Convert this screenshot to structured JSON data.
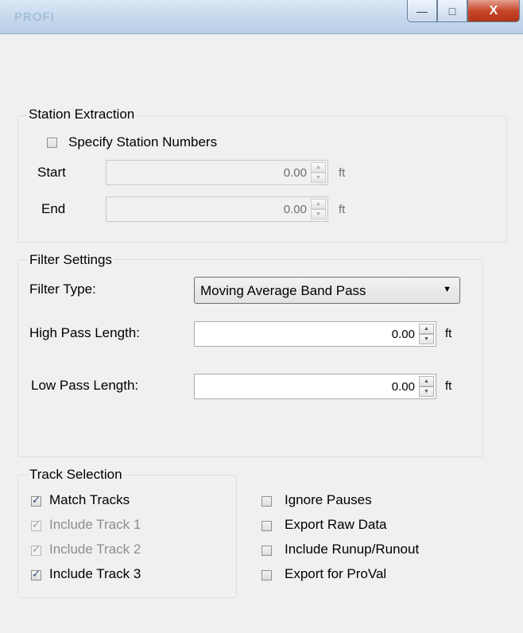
{
  "window": {
    "title": "PROFI",
    "buttons": {
      "minimize": "—",
      "maximize": "□",
      "close": "X"
    }
  },
  "station_extraction": {
    "legend": "Station Extraction",
    "specify_label": "Specify Station Numbers",
    "specify_checked": false,
    "start_label": "Start",
    "start_value": "0.00",
    "end_label": "End",
    "end_value": "0.00",
    "unit": "ft"
  },
  "filter_settings": {
    "legend": "Filter Settings",
    "type_label": "Filter Type:",
    "type_value": "Moving Average Band Pass",
    "high_label": "High Pass Length:",
    "high_value": "0.00",
    "low_label": "Low Pass Length:",
    "low_value": "0.00",
    "unit": "ft"
  },
  "track_selection": {
    "legend": "Track Selection",
    "match_tracks": {
      "label": "Match Tracks",
      "checked": true
    },
    "track1": {
      "label": "Include Track 1",
      "checked": true
    },
    "track2": {
      "label": "Include Track 2",
      "checked": true
    },
    "track3": {
      "label": "Include Track 3",
      "checked": true
    }
  },
  "options": {
    "ignore_pauses": "Ignore Pauses",
    "export_raw": "Export Raw Data",
    "include_runup": "Include Runup/Runout",
    "export_proval": "Export for ProVal"
  }
}
